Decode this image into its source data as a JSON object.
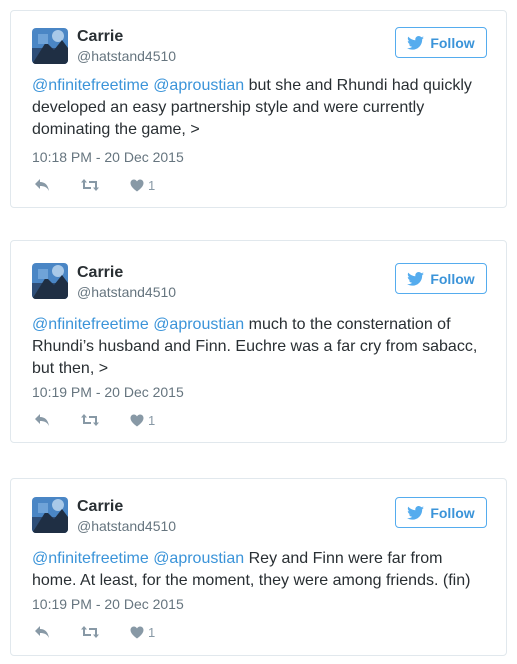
{
  "tweets": [
    {
      "name": "Carrie",
      "handle": "@hatstand4510",
      "follow_label": "Follow",
      "mentions": [
        "@nfinitefreetime",
        "@aproustian"
      ],
      "text": "but she and Rhundi had quickly developed an easy partnership style and were currently dominating the game, >",
      "timestamp": "10:18 PM - 20 Dec 2015",
      "like_count": "1"
    },
    {
      "name": "Carrie",
      "handle": "@hatstand4510",
      "follow_label": "Follow",
      "mentions": [
        "@nfinitefreetime",
        "@aproustian"
      ],
      "text": "much to the consternation of Rhundi’s husband and Finn. Euchre was a far cry from sabacc, but then, >",
      "timestamp": "10:19 PM - 20 Dec 2015",
      "like_count": "1"
    },
    {
      "name": "Carrie",
      "handle": "@hatstand4510",
      "follow_label": "Follow",
      "mentions": [
        "@nfinitefreetime",
        "@aproustian"
      ],
      "text": "Rey and Finn were far from home. At least, for the moment, they were among friends. (fin)",
      "timestamp": "10:19 PM - 20 Dec 2015",
      "like_count": "1"
    }
  ],
  "icons": {
    "follow": "twitter-bird-icon",
    "reply": "reply-icon",
    "retweet": "retweet-icon",
    "like": "heart-icon"
  },
  "colors": {
    "link": "#3b94d9",
    "follow_border": "#55acee",
    "muted": "#66757f",
    "action": "#8899a6",
    "border": "#e1e8ed"
  }
}
